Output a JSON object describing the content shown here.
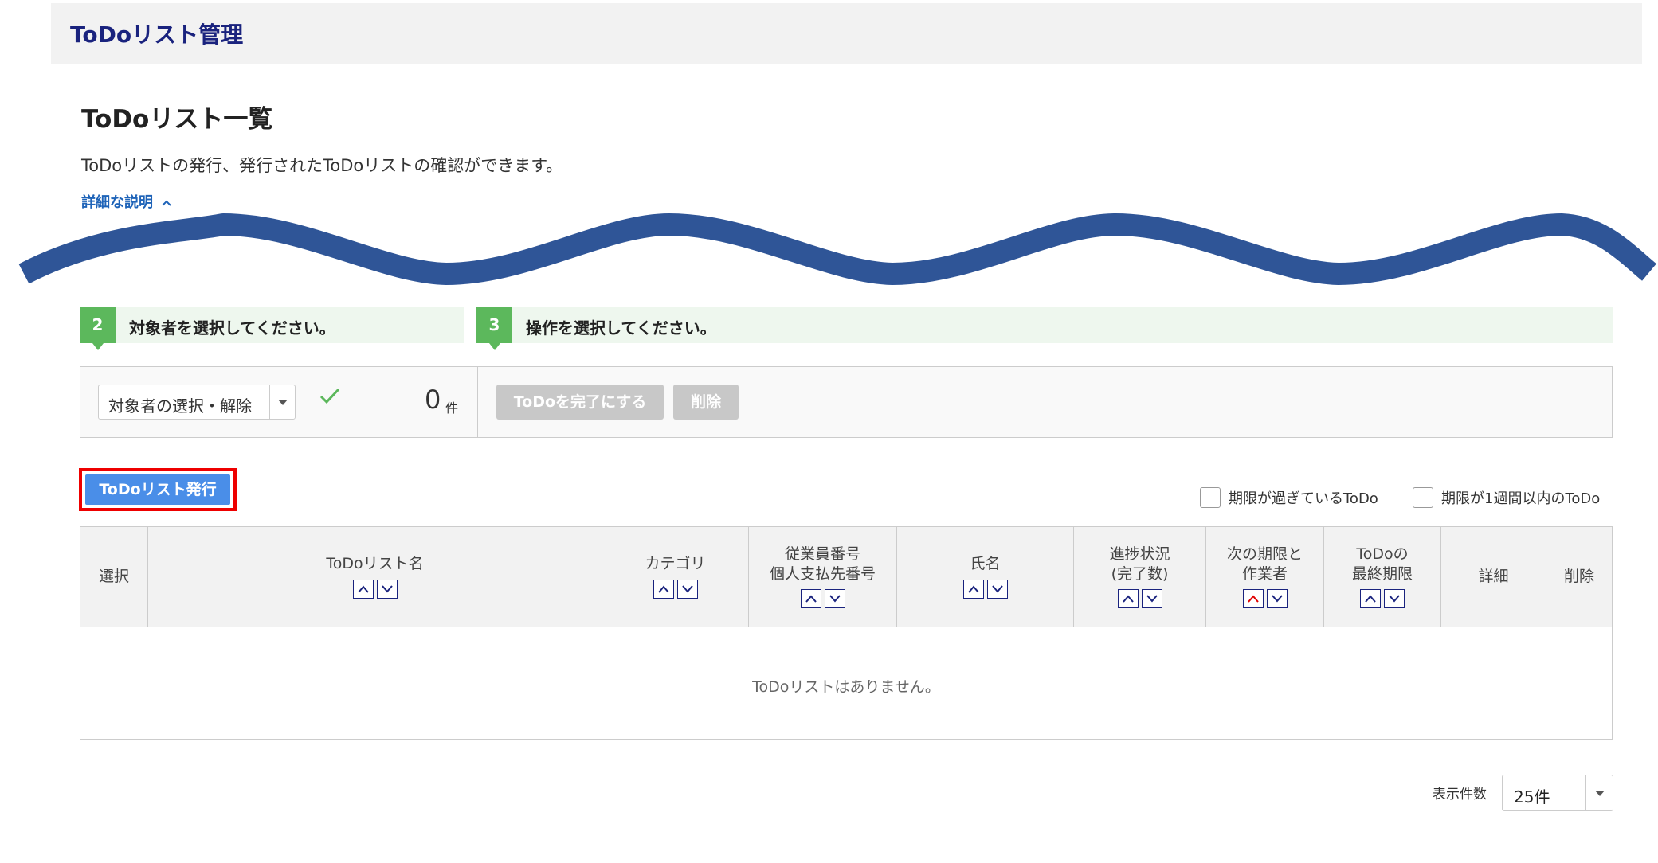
{
  "header": {
    "app_title": "ToDoリスト管理"
  },
  "page": {
    "title": "ToDoリスト一覧",
    "description": "ToDoリストの発行、発行されたToDoリストの確認ができます。",
    "detail_link": "詳細な説明"
  },
  "steps": [
    {
      "number": "2",
      "label": "対象者を選択してください。"
    },
    {
      "number": "3",
      "label": "操作を選択してください。"
    }
  ],
  "selection": {
    "select_label": "対象者の選択・解除",
    "count": "0",
    "count_unit": "件",
    "complete_button": "ToDoを完了にする",
    "delete_button": "削除"
  },
  "issue_button": "ToDoリスト発行",
  "filters": [
    {
      "label": "期限が過ぎているToDo",
      "checked": false
    },
    {
      "label": "期限が1週間以内のToDo",
      "checked": false
    }
  ],
  "table": {
    "columns": [
      {
        "lines": [
          "選択"
        ]
      },
      {
        "lines": [
          "ToDoリスト名"
        ]
      },
      {
        "lines": [
          "カテゴリ"
        ]
      },
      {
        "lines": [
          "従業員番号",
          "個人支払先番号"
        ]
      },
      {
        "lines": [
          "氏名"
        ]
      },
      {
        "lines": [
          "進捗状況",
          "(完了数)"
        ]
      },
      {
        "lines": [
          "次の期限と",
          "作業者"
        ]
      },
      {
        "lines": [
          "ToDoの",
          "最終期限"
        ]
      },
      {
        "lines": [
          "詳細"
        ]
      },
      {
        "lines": [
          "削除"
        ]
      }
    ],
    "empty_message": "ToDoリストはありません。"
  },
  "pagination": {
    "per_page_label": "表示件数",
    "per_page_value": "25件"
  },
  "colors": {
    "header_title": "#1a237e",
    "step_green": "#5cb85c",
    "primary_button": "#4a8ee8",
    "highlight_frame": "#e00000",
    "wave": "#2f5597",
    "active_sort": "#e00000"
  }
}
